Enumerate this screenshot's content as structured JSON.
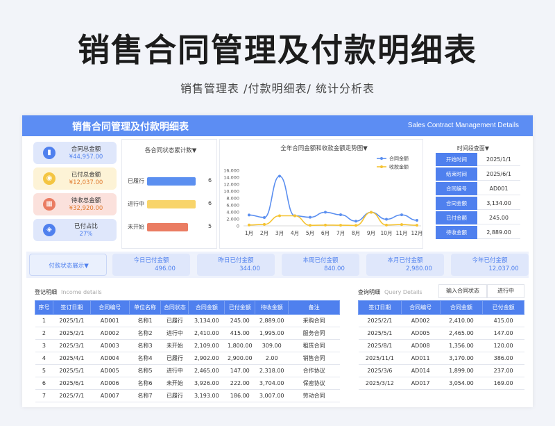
{
  "page": {
    "title": "销售合同管理及付款明细表",
    "subtitle": "销售管理表 /付款明细表/ 统计分析表"
  },
  "banner": {
    "title_cn": "销售合同管理及付款明细表",
    "title_en": "Sales Contract Management Details"
  },
  "summary": [
    {
      "label": "合同总金额",
      "value": "¥44,957.00",
      "icon": "bar-chart-icon",
      "bg": "#dfe7fb",
      "icon_color": "#4f80ee",
      "value_color": "#4f80ee"
    },
    {
      "label": "已付总金额",
      "value": "¥12,037.00",
      "icon": "coins-icon",
      "bg": "#fdf3d6",
      "icon_color": "#f4c542",
      "value_color": "#e07a2e"
    },
    {
      "label": "待收总金额",
      "value": "¥32,920.00",
      "icon": "calendar-icon",
      "bg": "#fbe1dc",
      "icon_color": "#ea7c62",
      "value_color": "#e07a2e"
    },
    {
      "label": "已付占比",
      "value": "27%",
      "icon": "layers-icon",
      "bg": "#dfe7fb",
      "icon_color": "#4f80ee",
      "value_color": "#4f80ee"
    }
  ],
  "status_chart": {
    "title": "各合同状态累计数▼",
    "chart_data": {
      "type": "bar",
      "orientation": "horizontal",
      "categories": [
        "已履行",
        "进行中",
        "未开始"
      ],
      "values": [
        6,
        6,
        5
      ],
      "colors": [
        "#5b8ff0",
        "#f8d46a",
        "#ea7c62"
      ],
      "xlim": [
        0,
        7
      ]
    }
  },
  "line_chart": {
    "title": "全年合同金额和收款金额走势图▼",
    "chart_data": {
      "type": "line",
      "x": [
        "1月",
        "2月",
        "3月",
        "4月",
        "5月",
        "6月",
        "7月",
        "8月",
        "9月",
        "10月",
        "11月",
        "12月"
      ],
      "yticks": [
        "16,000",
        "14,000",
        "12,000",
        "10,000",
        "8,000",
        "6,000",
        "4,000",
        "2,000",
        "0"
      ],
      "ylim": [
        0,
        16000
      ],
      "series": [
        {
          "name": "合同金额",
          "color": "#5b8ff0",
          "values": [
            3134,
            2410,
            14300,
            2900,
            2465,
            3926,
            3193,
            1356,
            3900,
            1899,
            3170,
            1600
          ]
        },
        {
          "name": "收款金额",
          "color": "#f5c332",
          "values": [
            245,
            415,
            2900,
            2900,
            147,
            222,
            186,
            120,
            3900,
            237,
            386,
            169
          ]
        }
      ],
      "legend": "top-right"
    }
  },
  "query_panel": {
    "title": "时间段查面▼",
    "rows": [
      {
        "key": "开始时间",
        "value": "2025/1/1"
      },
      {
        "key": "结束时间",
        "value": "2025/6/1"
      },
      {
        "key": "合同编号",
        "value": "AD001"
      },
      {
        "key": "合同金额",
        "value": "3,134.00"
      },
      {
        "key": "已付金额",
        "value": "245.00"
      },
      {
        "key": "待收金额",
        "value": "2,889.00"
      }
    ]
  },
  "stats": {
    "dropdown_label": "付款状态展示▼",
    "boxes": [
      {
        "label": "今日已付金额",
        "value": "496.00"
      },
      {
        "label": "昨日已付金额",
        "value": "344.00"
      },
      {
        "label": "本周已付金额",
        "value": "840.00"
      },
      {
        "label": "本月已付金额",
        "value": "2,980.00"
      },
      {
        "label": "今年已付金额",
        "value": "12,037.00"
      }
    ]
  },
  "register": {
    "title": "登记明细",
    "title_en": "Income details",
    "columns": [
      "序号",
      "签订日期",
      "合同编号",
      "单位名称",
      "合同状态",
      "合同金额",
      "已付金额",
      "待收金额",
      "备注"
    ],
    "rows": [
      [
        "1",
        "2025/1/1",
        "AD001",
        "名称1",
        "已履行",
        "3,134.00",
        "245.00",
        "2,889.00",
        "采购合同"
      ],
      [
        "2",
        "2025/2/1",
        "AD002",
        "名称2",
        "进行中",
        "2,410.00",
        "415.00",
        "1,995.00",
        "服务合同"
      ],
      [
        "3",
        "2025/3/1",
        "AD003",
        "名称3",
        "未开始",
        "2,109.00",
        "1,800.00",
        "309.00",
        "租赁合同"
      ],
      [
        "4",
        "2025/4/1",
        "AD004",
        "名称4",
        "已履行",
        "2,902.00",
        "2,900.00",
        "2.00",
        "销售合同"
      ],
      [
        "5",
        "2025/5/1",
        "AD005",
        "名称5",
        "进行中",
        "2,465.00",
        "147.00",
        "2,318.00",
        "合作协议"
      ],
      [
        "6",
        "2025/6/1",
        "AD006",
        "名称6",
        "未开始",
        "3,926.00",
        "222.00",
        "3,704.00",
        "保密协议"
      ],
      [
        "7",
        "2025/7/1",
        "AD007",
        "名称7",
        "已履行",
        "3,193.00",
        "186.00",
        "3,007.00",
        "劳动合同"
      ]
    ]
  },
  "query_detail": {
    "title": "查询明细",
    "title_en": "Query Details",
    "input_label": "输入合同状态",
    "input_value": "进行中",
    "columns": [
      "签订日期",
      "合同编号",
      "合同金额",
      "已付金额"
    ],
    "rows": [
      [
        "2025/2/1",
        "AD002",
        "2,410.00",
        "415.00"
      ],
      [
        "2025/5/1",
        "AD005",
        "2,465.00",
        "147.00"
      ],
      [
        "2025/8/1",
        "AD008",
        "1,356.00",
        "120.00"
      ],
      [
        "2025/11/1",
        "AD011",
        "3,170.00",
        "386.00"
      ],
      [
        "2025/3/6",
        "AD014",
        "1,899.00",
        "237.00"
      ],
      [
        "2025/3/12",
        "AD017",
        "3,054.00",
        "169.00"
      ]
    ]
  }
}
